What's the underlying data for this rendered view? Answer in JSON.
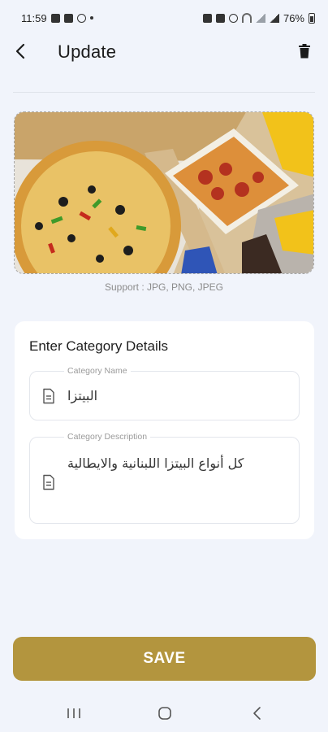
{
  "status_bar": {
    "time": "11:59",
    "battery": "76%"
  },
  "header": {
    "title": "Update"
  },
  "image": {
    "support_text": "Support : JPG, PNG, JPEG"
  },
  "card": {
    "title": "Enter Category Details",
    "name_field": {
      "label": "Category Name",
      "value": "البيتزا"
    },
    "description_field": {
      "label": "Category Description",
      "value": "كل أنواع البيتزا اللبنانية والايطالية"
    }
  },
  "save_button": {
    "label": "SAVE"
  },
  "colors": {
    "background": "#f1f4fb",
    "accent": "#b3953e",
    "card": "#ffffff"
  },
  "icons": {
    "back": "back-arrow-icon",
    "delete": "trash-icon",
    "field": "document-icon"
  }
}
